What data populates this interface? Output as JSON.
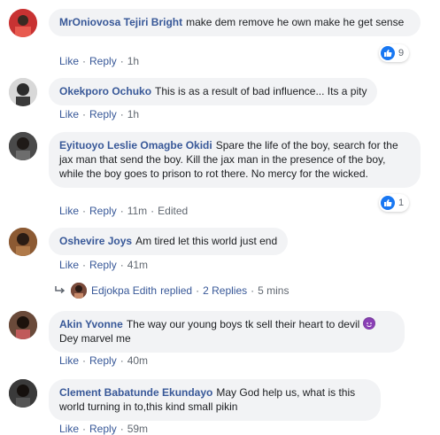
{
  "comments": [
    {
      "name": "MrOniovosa Tejiri Bright",
      "text": "make dem remove he own make he get sense",
      "like": "Like",
      "reply": "Reply",
      "time": "1h",
      "reaction_count": "9"
    },
    {
      "name": "Okekporo Ochuko",
      "text": "This is as a result of bad influence... Its a pity",
      "like": "Like",
      "reply": "Reply",
      "time": "1h"
    },
    {
      "name": "Eyituoyo Leslie Omagbe Okidi",
      "text": "Spare the life of the boy, search for the jax man that send the boy. Kill the jax man in the presence of the boy, while the boy goes to prison to rot there. No mercy for the wicked.",
      "like": "Like",
      "reply": "Reply",
      "time": "11m",
      "edited": "Edited",
      "reaction_count": "1"
    },
    {
      "name": "Oshevire Joys",
      "text": "Am tired let this world just end",
      "like": "Like",
      "reply": "Reply",
      "time": "41m"
    },
    {
      "name": "Akin Yvonne",
      "text": "The way our young boys tk sell their heart to devil",
      "text2": "Dey marvel me",
      "like": "Like",
      "reply": "Reply",
      "time": "40m"
    },
    {
      "name": "Clement Babatunde Ekundayo",
      "text": "May God help us, what is this world turning in to,this kind small pikin",
      "like": "Like",
      "reply": "Reply",
      "time": "59m"
    }
  ],
  "reply_summary": {
    "replier": "Edjokpa Edith",
    "replied": "replied",
    "count_label": "2 Replies",
    "time": "5 mins"
  },
  "colors": {
    "name": "#385898",
    "bubble": "#f2f3f5",
    "meta": "#606770",
    "like_badge": "#1877f2"
  },
  "icons": {
    "like": "thumbs-up-icon",
    "reply_arrow": "reply-arrow-icon",
    "emoji": "smiling-devil-emoji"
  }
}
